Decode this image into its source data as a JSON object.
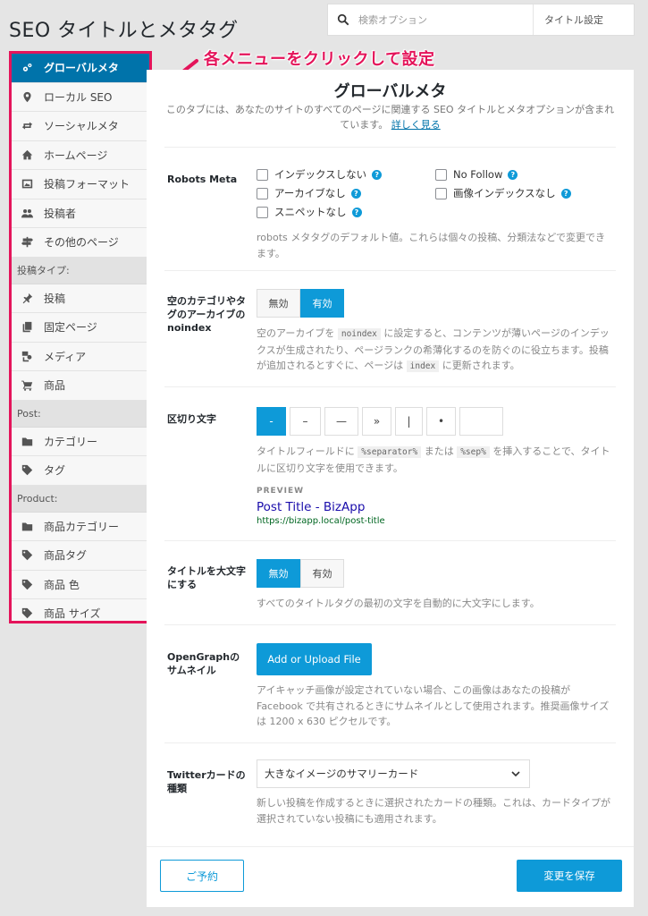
{
  "page_title": "SEO タイトルとメタタグ",
  "search": {
    "placeholder": "検索オプション",
    "context": "タイトル設定"
  },
  "annotation": "各メニューをクリックして設定",
  "sidebar": {
    "items": [
      {
        "label": "グローバルメタ",
        "icon": "gears-icon",
        "active": true
      },
      {
        "label": "ローカル SEO",
        "icon": "location-pin-icon"
      },
      {
        "label": "ソーシャルメタ",
        "icon": "share-icon"
      },
      {
        "label": "ホームページ",
        "icon": "home-icon"
      },
      {
        "label": "投稿フォーマット",
        "icon": "image-icon"
      },
      {
        "label": "投稿者",
        "icon": "users-icon"
      },
      {
        "label": "その他のページ",
        "icon": "signpost-icon"
      }
    ],
    "group_post_types": "投稿タイプ:",
    "post_types": [
      {
        "label": "投稿",
        "icon": "pin-icon"
      },
      {
        "label": "固定ページ",
        "icon": "pages-icon"
      },
      {
        "label": "メディア",
        "icon": "media-icon"
      },
      {
        "label": "商品",
        "icon": "cart-icon"
      }
    ],
    "group_post": "Post:",
    "post_tax": [
      {
        "label": "カテゴリー",
        "icon": "folder-icon"
      },
      {
        "label": "タグ",
        "icon": "tag-icon"
      }
    ],
    "group_product": "Product:",
    "product_tax": [
      {
        "label": "商品カテゴリー",
        "icon": "folder-icon"
      },
      {
        "label": "商品タグ",
        "icon": "tag-icon"
      },
      {
        "label": "商品 色",
        "icon": "tag-icon"
      },
      {
        "label": "商品 サイズ",
        "icon": "tag-icon"
      }
    ]
  },
  "main": {
    "title": "グローバルメタ",
    "description": "このタブには、あなたのサイトのすべてのページに関連する SEO タイトルとメタオプションが含まれています。",
    "learn_more": "詳しく見る",
    "robots": {
      "label": "Robots Meta",
      "options": [
        "インデックスしない",
        "No Follow",
        "アーカイブなし",
        "画像インデックスなし",
        "スニペットなし"
      ],
      "help": "robots メタタグのデフォルト値。これらは個々の投稿、分類法などで変更できます。"
    },
    "noindex_empty": {
      "label": "空のカテゴリやタグのアーカイブの noindex",
      "off": "無効",
      "on": "有効",
      "help_1": "空のアーカイブを",
      "code_1": "noindex",
      "help_2": "に設定すると、コンテンツが薄いページのインデックスが生成されたり、ページランクの希薄化するのを防ぐのに役立ちます。投稿が追加されるとすぐに、ページは",
      "code_2": "index",
      "help_3": "に更新されます。"
    },
    "separator": {
      "label": "区切り文字",
      "options": [
        "-",
        "–",
        "—",
        "»",
        "|",
        "•"
      ],
      "help_1": "タイトルフィールドに",
      "code_1": "%separator%",
      "help_2": "または",
      "code_2": "%sep%",
      "help_3": "を挿入することで、タイトルに区切り文字を使用できます。",
      "preview_label": "PREVIEW",
      "preview_title": "Post Title - BizApp",
      "preview_url": "https://bizapp.local/post-title"
    },
    "capitalize": {
      "label": "タイトルを大文字にする",
      "off": "無効",
      "on": "有効",
      "help": "すべてのタイトルタグの最初の文字を自動的に大文字にします。"
    },
    "og_thumb": {
      "label": "OpenGraphのサムネイル",
      "button": "Add or Upload File",
      "help": "アイキャッチ画像が設定されていない場合、この画像はあなたの投稿が Facebook で共有されるときにサムネイルとして使用されます。推奨画像サイズは 1200 x 630 ピクセルです。"
    },
    "twitter": {
      "label": "Twitterカードの種類",
      "selected": "大きなイメージのサマリーカード",
      "help": "新しい投稿を作成するときに選択されたカードの種類。これは、カードタイプが選択されていない投稿にも適用されます。"
    }
  },
  "footer": {
    "reset": "ご予約",
    "save": "変更を保存"
  },
  "colors": {
    "accent": "#0e9ad8",
    "active_nav": "#0073aa",
    "highlight": "#e4145a"
  }
}
